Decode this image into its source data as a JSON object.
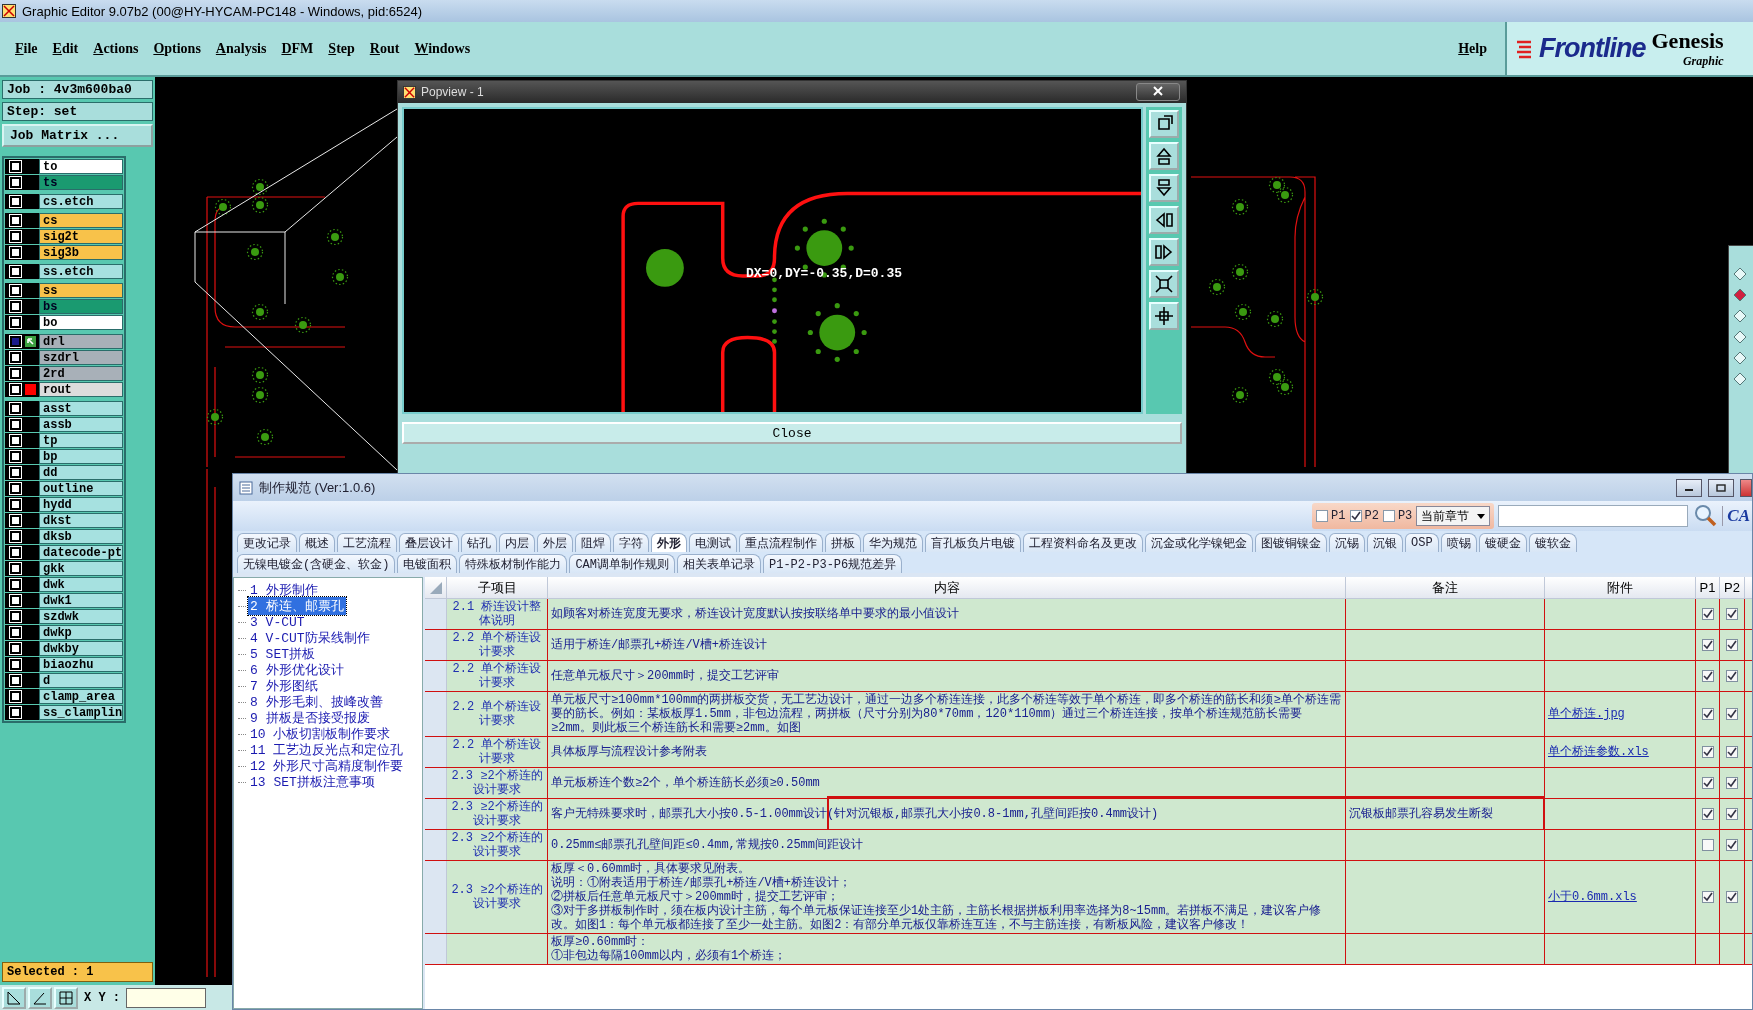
{
  "app_title": "Graphic Editor 9.07b2 (00@HY-HYCAM-PC148 - Windows, pid:6524)",
  "menu": [
    "File",
    "Edit",
    "Actions",
    "Options",
    "Analysis",
    "DFM",
    "Step",
    "Rout",
    "Windows"
  ],
  "help": "Help",
  "logo": {
    "brand": "Frontline",
    "product": "Genesis",
    "subtitle": "Graphic"
  },
  "job": {
    "job_label": "Job : 4v3m600ba0",
    "step_label": "Step: set",
    "matrix_button": "Job Matrix ..."
  },
  "layer_groups": [
    [
      {
        "name": "to",
        "color": "#ffffff",
        "checked": false,
        "kind": "plain"
      },
      {
        "name": "ts",
        "color": "#1a9a70",
        "checked": false,
        "kind": "plain"
      }
    ],
    [
      {
        "name": "cs.etch",
        "color": "#a6e1e0",
        "checked": false,
        "kind": "plain"
      }
    ],
    [
      {
        "name": "cs",
        "color": "#f8c24a",
        "checked": false,
        "kind": "plain"
      },
      {
        "name": "sig2t",
        "color": "#f8c24a",
        "checked": false,
        "kind": "plain"
      },
      {
        "name": "sig3b",
        "color": "#f8c24a",
        "checked": false,
        "kind": "plain"
      }
    ],
    [
      {
        "name": "ss.etch",
        "color": "#a6e1e0",
        "checked": false,
        "kind": "plain"
      }
    ],
    [
      {
        "name": "ss",
        "color": "#f8c24a",
        "checked": false,
        "kind": "plain"
      },
      {
        "name": "bs",
        "color": "#1a9a70",
        "checked": false,
        "kind": "plain"
      },
      {
        "name": "bo",
        "color": "#ffffff",
        "checked": false,
        "kind": "plain"
      }
    ],
    [
      {
        "name": "drl",
        "color": "#a8b0b8",
        "checked": true,
        "kind": "work"
      },
      {
        "name": "szdrl",
        "color": "#a8b0b8",
        "checked": false,
        "kind": "plain"
      },
      {
        "name": "2rd",
        "color": "#a8b0b8",
        "checked": false,
        "kind": "plain"
      },
      {
        "name": "rout",
        "color": "#dcdcdc",
        "checked": false,
        "kind": "displayed"
      }
    ],
    [
      {
        "name": "asst",
        "color": "#a6e1e0",
        "checked": false,
        "kind": "plain"
      },
      {
        "name": "assb",
        "color": "#a6e1e0",
        "checked": false,
        "kind": "plain"
      },
      {
        "name": "tp",
        "color": "#a6e1e0",
        "checked": false,
        "kind": "plain"
      },
      {
        "name": "bp",
        "color": "#a6e1e0",
        "checked": false,
        "kind": "plain"
      },
      {
        "name": "dd",
        "color": "#a6e1e0",
        "checked": false,
        "kind": "plain"
      },
      {
        "name": "outline",
        "color": "#a6e1e0",
        "checked": false,
        "kind": "plain"
      },
      {
        "name": "hydd",
        "color": "#a6e1e0",
        "checked": false,
        "kind": "plain"
      },
      {
        "name": "dkst",
        "color": "#a6e1e0",
        "checked": false,
        "kind": "plain"
      },
      {
        "name": "dksb",
        "color": "#a6e1e0",
        "checked": false,
        "kind": "plain"
      },
      {
        "name": "datecode-pt",
        "color": "#a6e1e0",
        "checked": false,
        "kind": "plain"
      },
      {
        "name": "gkk",
        "color": "#a6e1e0",
        "checked": false,
        "kind": "plain"
      },
      {
        "name": "dwk",
        "color": "#a6e1e0",
        "checked": false,
        "kind": "plain"
      },
      {
        "name": "dwk1",
        "color": "#a6e1e0",
        "checked": false,
        "kind": "plain"
      },
      {
        "name": "szdwk",
        "color": "#a6e1e0",
        "checked": false,
        "kind": "plain"
      },
      {
        "name": "dwkp",
        "color": "#a6e1e0",
        "checked": false,
        "kind": "plain"
      },
      {
        "name": "dwkby",
        "color": "#a6e1e0",
        "checked": false,
        "kind": "plain"
      },
      {
        "name": "biaozhu",
        "color": "#a6e1e0",
        "checked": false,
        "kind": "plain"
      },
      {
        "name": "d",
        "color": "#a6e1e0",
        "checked": false,
        "kind": "plain"
      },
      {
        "name": "clamp_area",
        "color": "#a6e1e0",
        "checked": false,
        "kind": "plain"
      },
      {
        "name": "ss_clamplin",
        "color": "#a6e1e0",
        "checked": false,
        "kind": "plain"
      }
    ]
  ],
  "selected_count": "Selected : 1",
  "coord": {
    "label": "X Y :"
  },
  "popview": {
    "title": "Popview - 1",
    "measurement": "DX=0,DY=-0.35,D=0.35",
    "close_button": "Close"
  },
  "spec_window": {
    "title": "制作规范 (Ver:1.0.6)",
    "filters": [
      {
        "label": "P1",
        "checked": false
      },
      {
        "label": "P2",
        "checked": true
      },
      {
        "label": "P3",
        "checked": false
      }
    ],
    "scope": "当前章节",
    "logo": "CA",
    "tabs_row1": [
      {
        "label": "更改记录",
        "selected": false
      },
      {
        "label": "概述",
        "selected": false
      },
      {
        "label": "工艺流程",
        "selected": false
      },
      {
        "label": "叠层设计",
        "selected": false
      },
      {
        "label": "钻孔",
        "selected": false
      },
      {
        "label": "内层",
        "selected": false
      },
      {
        "label": "外层",
        "selected": false
      },
      {
        "label": "阻焊",
        "selected": false
      },
      {
        "label": "字符",
        "selected": false
      },
      {
        "label": "外形",
        "selected": true
      },
      {
        "label": "电测试",
        "selected": false
      },
      {
        "label": "重点流程制作",
        "selected": false
      },
      {
        "label": "拼板",
        "selected": false
      },
      {
        "label": "华为规范",
        "selected": false
      },
      {
        "label": "盲孔板负片电镀",
        "selected": false
      },
      {
        "label": "工程资料命名及更改",
        "selected": false
      },
      {
        "label": "沉金或化学镍钯金",
        "selected": false
      },
      {
        "label": "图镀铜镍金",
        "selected": false
      },
      {
        "label": "沉锡",
        "selected": false
      },
      {
        "label": "沉银",
        "selected": false
      },
      {
        "label": "OSP",
        "selected": false
      },
      {
        "label": "喷锡",
        "selected": false
      },
      {
        "label": "镀硬金",
        "selected": false
      },
      {
        "label": "镀软金",
        "selected": false
      }
    ],
    "tabs_row2": [
      {
        "label": "无镍电镀金(含硬金、软金)",
        "selected": false
      },
      {
        "label": "电镀面积",
        "selected": false
      },
      {
        "label": "特殊板材制作能力",
        "selected": false
      },
      {
        "label": "CAM调单制作规则",
        "selected": false
      },
      {
        "label": "相关表单记录",
        "selected": false
      },
      {
        "label": "P1-P2-P3-P6规范差异",
        "selected": false
      }
    ],
    "tree": [
      {
        "label": "1 外形制作",
        "selected": false
      },
      {
        "label": "2 桥连、邮票孔",
        "selected": true
      },
      {
        "label": "3 V-CUT",
        "selected": false
      },
      {
        "label": "4 V-CUT防呆线制作",
        "selected": false
      },
      {
        "label": "5 SET拼板",
        "selected": false
      },
      {
        "label": "6 外形优化设计",
        "selected": false
      },
      {
        "label": "7 外形图纸",
        "selected": false
      },
      {
        "label": "8 外形毛刺、披峰改善",
        "selected": false
      },
      {
        "label": "9 拼板是否接受报废",
        "selected": false
      },
      {
        "label": "10 小板切割板制作要求",
        "selected": false
      },
      {
        "label": "11 工艺边反光点和定位孔",
        "selected": false
      },
      {
        "label": "12 外形尺寸高精度制作要",
        "selected": false
      },
      {
        "label": "13 SET拼板注意事项",
        "selected": false
      }
    ],
    "columns": [
      "子项目",
      "内容",
      "备注",
      "附件",
      "P1",
      "P2"
    ],
    "rows": [
      {
        "subitem": "2.1 桥连设计整体说明",
        "content": [
          "如顾客对桥连宽度无要求，桥连设计宽度默认按按联络单中要求的最小值设计"
        ],
        "p1": true,
        "p2": true,
        "highlighted": false
      },
      {
        "subitem": "2.2 单个桥连设计要求",
        "content": [
          "适用于桥连/邮票孔+桥连/V槽+桥连设计"
        ],
        "p1": true,
        "p2": true,
        "highlighted": false
      },
      {
        "subitem": "2.2 单个桥连设计要求",
        "content": [
          "任意单元板尺寸＞200mm时，提交工艺评审"
        ],
        "p1": true,
        "p2": true,
        "highlighted": false
      },
      {
        "subitem": "2.2 单个桥连设计要求",
        "content": [
          "单元板尺寸≥100mm*100mm的两拼板交货，无工艺边设计，通过一边多个桥连连接，此多个桥连等效于单个桥连，即多个桥连的筋长和须≥单个桥连需要的筋长。例如：某板板厚1.5mm，非包边流程，两拼板（尺寸分别为80*70mm，120*110mm）通过三个桥连连接，按单个桥连规范筋长需要≥2mm。则此板三个桥连筋长和需要≥2mm。如图"
        ],
        "attachment": "单个桥连.jpg",
        "p1": true,
        "p2": true,
        "highlighted": false
      },
      {
        "subitem": "2.2 单个桥连设计要求",
        "content": [
          "具体板厚与流程设计参考附表"
        ],
        "attachment": "单个桥连参数.xls",
        "p1": true,
        "p2": true,
        "highlighted": false
      },
      {
        "subitem": "2.3 ≥2个桥连的设计要求",
        "content": [
          "单元板桥连个数≥2个，单个桥连筋长必须≥0.50mm"
        ],
        "p1": true,
        "p2": true,
        "highlighted": false
      },
      {
        "subitem": "2.3 ≥2个桥连的设计要求",
        "content": [
          "客户无特殊要求时，邮票孔大小按0.5-1.00mm设计(针对沉银板,邮票孔大小按0.8-1mm,孔壁间距按0.4mm设计)"
        ],
        "remark": "沉银板邮票孔容易发生断裂",
        "p1": true,
        "p2": true,
        "highlighted": true
      },
      {
        "subitem": "2.3 ≥2个桥连的设计要求",
        "content": [
          "0.25mm≤邮票孔孔壁间距≤0.4mm,常规按0.25mm间距设计"
        ],
        "p1": false,
        "p2": true,
        "highlighted": false
      },
      {
        "subitem": "2.3 ≥2个桥连的设计要求",
        "content": [
          "板厚＜0.60mm时，具体要求见附表。",
          "说明：①附表适用于桥连/邮票孔+桥连/V槽+桥连设计；",
          "②拼板后任意单元板尺寸＞200mm时，提交工艺评审；",
          "③对于多拼板制作时，须在板内设计主筋，每个单元板保证连接至少1处主筋，主筋长根据拼板利用率选择为8~15mm。若拼板不满足，建议客户修改。如图1：每个单元板都连接了至少一处主筋。如图2：有部分单元板仅靠桥连互连，不与主筋连接，有断板风险，建议客户修改！"
        ],
        "attachment": "小于0.6mm.xls",
        "p1": true,
        "p2": true,
        "highlighted": false
      },
      {
        "content": [
          "板厚≥0.60mm时：",
          "①非包边每隔100mm以内，必须有1个桥连；"
        ],
        "highlighted": false
      }
    ]
  }
}
